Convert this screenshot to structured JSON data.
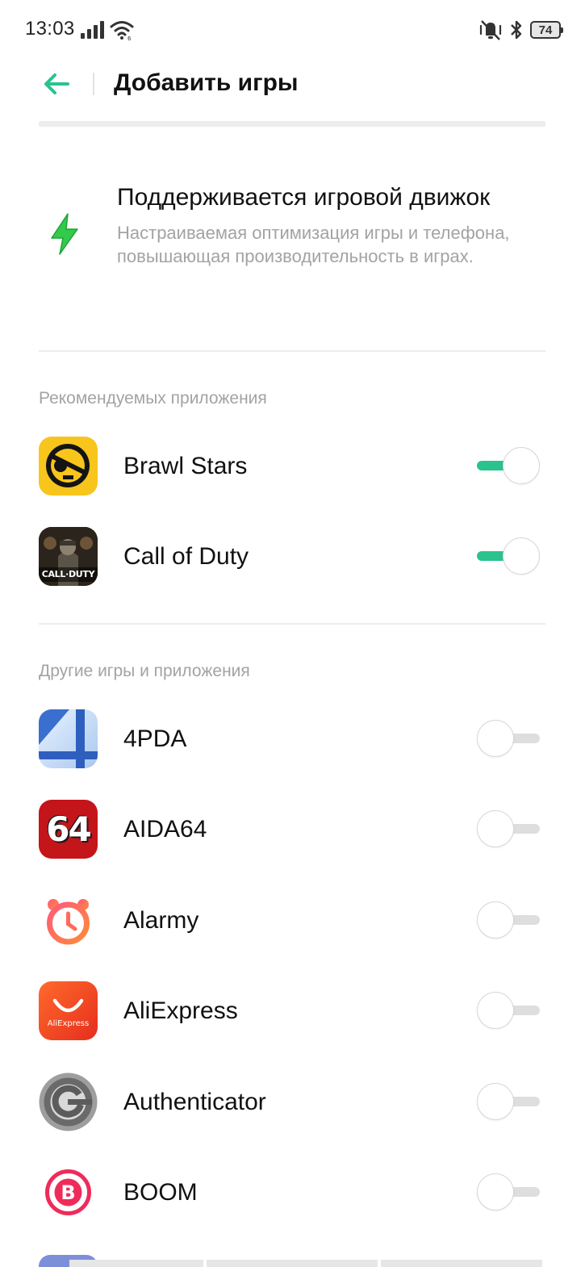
{
  "status_bar": {
    "time": "13:03",
    "battery": "74",
    "icons": [
      "signal-icon",
      "wifi-icon",
      "mute-vibrate-icon",
      "bluetooth-icon",
      "battery-icon"
    ]
  },
  "header": {
    "title": "Добавить игры",
    "back_icon": "back-arrow-icon"
  },
  "feature": {
    "icon": "bolt-icon",
    "title": "Поддерживается игровой движок",
    "description": "Настраиваемая оптимизация игры и телефона, повышающая производительность в играх."
  },
  "recommended": {
    "label": "Рекомендуемых приложения",
    "apps": [
      {
        "name": "Brawl Stars",
        "enabled": true
      },
      {
        "name": "Call of Duty",
        "enabled": true
      }
    ]
  },
  "others": {
    "label": "Другие игры и приложения",
    "apps": [
      {
        "name": "4PDA",
        "enabled": false
      },
      {
        "name": "AIDA64",
        "enabled": false
      },
      {
        "name": "Alarmy",
        "enabled": false
      },
      {
        "name": "AliExpress",
        "enabled": false
      },
      {
        "name": "Authenticator",
        "enabled": false
      },
      {
        "name": "BOOM",
        "enabled": false
      }
    ]
  },
  "icon_text": {
    "aida": "64",
    "cod": "CALL·DUTY",
    "aliexpress": "AliExpress",
    "boom": "B"
  },
  "colors": {
    "accent": "#2ac38e",
    "feature_icon": "#33c94a",
    "secondary_text": "#a3a3a3"
  }
}
